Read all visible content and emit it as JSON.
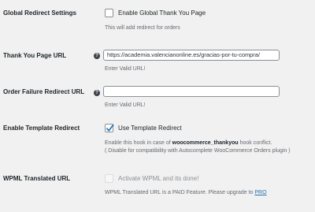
{
  "global_redirect": {
    "label": "Global Redirect Settings",
    "checkbox_label": "Enable Global Thank You Page",
    "checked": false,
    "description": "This will add redirect for orders"
  },
  "thankyou_url": {
    "label": "Thank You Page URL",
    "value": "https://academia.valencianonline.es/gracias-por-tu-compra/",
    "hint": "Enter Valid URL!"
  },
  "failure_url": {
    "label": "Order Failure Redirect URL",
    "value": "",
    "hint": "Enter Valid URL!"
  },
  "template_redirect": {
    "label": "Enable Template Redirect",
    "checkbox_label": "Use Template Redirect",
    "checked": true,
    "desc_prefix": "Enable this hook in case of ",
    "desc_hook": "woocommerce_thankyou",
    "desc_suffix": " hook conflict.",
    "desc_line2": "( Disable for compatibility with Autocomplete WooCommerce Orders plugin )"
  },
  "wpml": {
    "label": "WPML Translated URL",
    "checkbox_label": "Activate WPML and its done!",
    "checked": false,
    "desc_prefix": "WPML Translated URL is a PAID Feature. Please upgrade to ",
    "pro_link": "PRO"
  },
  "colors": {
    "background": "#f1f1f1",
    "link": "#2271b1",
    "check": "#2271b1"
  },
  "icons": {
    "help": "help-icon",
    "check": "checkmark-icon"
  }
}
